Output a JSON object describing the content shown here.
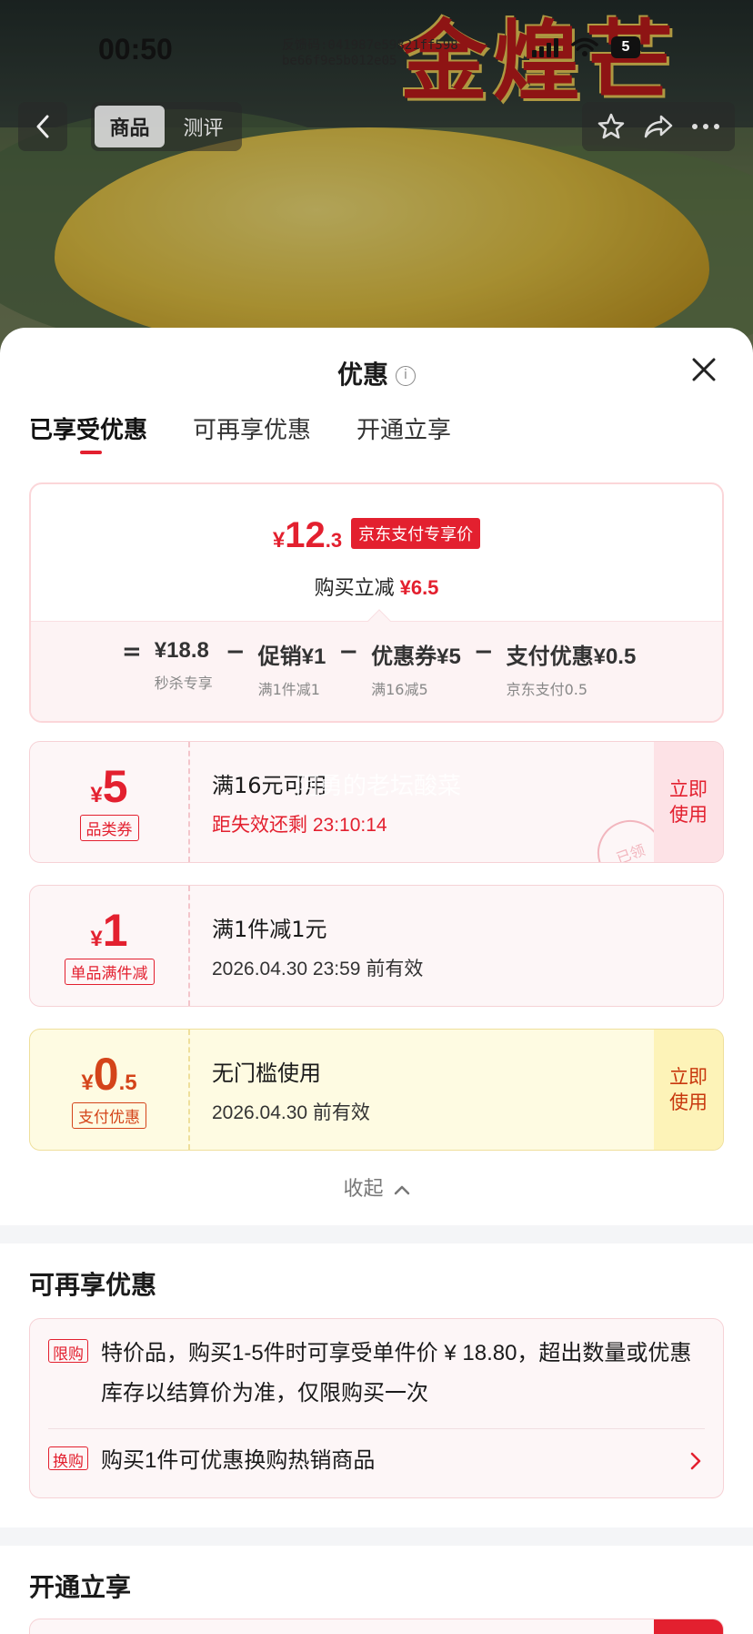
{
  "status_bar": {
    "time": "00:50",
    "feedback_line1": "反馈码:041987e59821ff598",
    "feedback_line2": "be66f9e5b012e05",
    "battery": "5"
  },
  "hero": {
    "brand_text": "金煌芒"
  },
  "nav": {
    "tabs": [
      {
        "label": "商品",
        "active": true
      },
      {
        "label": "测评",
        "active": false
      }
    ]
  },
  "sheet": {
    "title": "优惠",
    "tabs": [
      {
        "label": "已享受优惠",
        "active": true
      },
      {
        "label": "可再享优惠",
        "active": false
      },
      {
        "label": "开通立享",
        "active": false
      }
    ],
    "summary": {
      "currency": "¥",
      "price_int": "12",
      "price_dec": ".3",
      "pay_tag": "京东支付专享价",
      "reduce_label": "购买立减",
      "reduce_amount": "¥6.5",
      "formula": [
        {
          "op": "=",
          "main": "¥18.8",
          "sub": "秒杀专享"
        },
        {
          "op": "−",
          "main": "促销¥1",
          "sub": "满1件减1"
        },
        {
          "op": "−",
          "main": "优惠券¥5",
          "sub": "满16减5"
        },
        {
          "op": "−",
          "main": "支付优惠¥0.5",
          "sub": "京东支付0.5"
        }
      ]
    },
    "coupons": [
      {
        "currency": "¥",
        "int": "5",
        "dec": "",
        "kind": "品类券",
        "cond": "满16元可用",
        "exp": "距失效还剩 23:10:14",
        "exp_red": true,
        "use": "立即\n使用",
        "stamp": "已领",
        "watermark": "阿勇的老坛酸菜"
      },
      {
        "currency": "¥",
        "int": "1",
        "dec": "",
        "kind": "单品满件减",
        "cond": "满1件减1元",
        "exp": "2026.04.30 23:59 前有效",
        "exp_red": false,
        "use": ""
      },
      {
        "currency": "¥",
        "int": "0",
        "dec": ".5",
        "kind": "支付优惠",
        "cond": "无门槛使用",
        "exp": "2026.04.30 前有效",
        "exp_red": false,
        "use": "立即\n使用"
      }
    ],
    "collapse_label": "收起",
    "more": {
      "title": "可再享优惠",
      "items": [
        {
          "tag": "限购",
          "text": "特价品，购买1-5件时可享受单件价 ¥ 18.80，超出数量或优惠库存以结算价为准，仅限购买一次"
        },
        {
          "tag": "换购",
          "text": "购买1件可优惠换购热销商品"
        }
      ]
    },
    "open": {
      "title": "开通立享"
    }
  },
  "colors": {
    "accent": "#e3202f",
    "pay_yellow": "#fefbe2"
  }
}
